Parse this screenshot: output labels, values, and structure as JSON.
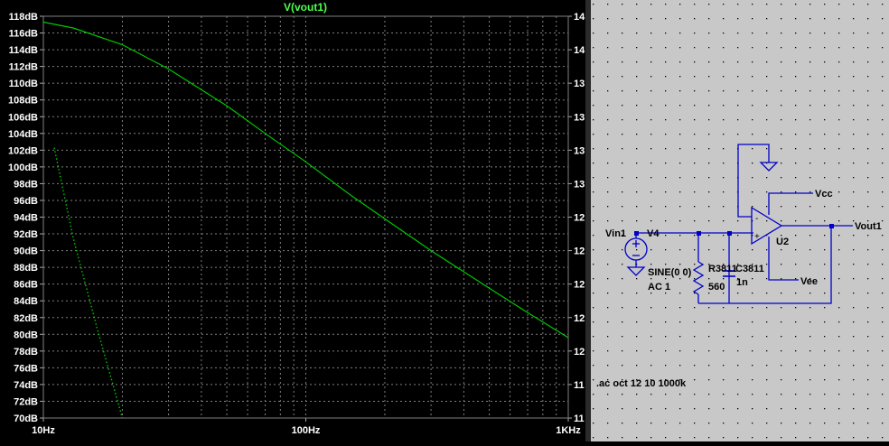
{
  "plot": {
    "title": "V(vout1)",
    "colors": {
      "background": "#000000",
      "grid": "#7f7f7f",
      "trace": "#00c800",
      "text": "#ffffff",
      "title": "#4cff4c"
    }
  },
  "chart_data": {
    "type": "line",
    "title": "V(vout1)",
    "x_scale": "log",
    "xlim": [
      10,
      1000
    ],
    "ylim": [
      70,
      118
    ],
    "y_ticks": [
      "70dB",
      "72dB",
      "74dB",
      "76dB",
      "78dB",
      "80dB",
      "82dB",
      "84dB",
      "86dB",
      "88dB",
      "90dB",
      "92dB",
      "94dB",
      "96dB",
      "98dB",
      "100dB",
      "102dB",
      "104dB",
      "106dB",
      "108dB",
      "110dB",
      "112dB",
      "114dB",
      "116dB",
      "118dB"
    ],
    "x_ticks": [
      {
        "value": 10,
        "label": "10Hz"
      },
      {
        "value": 100,
        "label": "100Hz"
      },
      {
        "value": 1000,
        "label": "1KHz"
      }
    ],
    "right_ticks": [
      "14",
      "14",
      "13",
      "13",
      "13",
      "13",
      "12",
      "12",
      "12",
      "12",
      "12",
      "11",
      "11"
    ],
    "grid": true,
    "series": [
      {
        "style": "solid",
        "x": [
          10,
          13,
          20,
          30,
          50,
          70,
          100,
          150,
          200,
          300,
          500,
          700,
          1000
        ],
        "y": [
          117.3,
          116.6,
          114.6,
          111.7,
          107.3,
          104.0,
          100.6,
          96.5,
          93.8,
          90.0,
          85.5,
          82.6,
          79.6
        ]
      },
      {
        "style": "dotted",
        "x": [
          11,
          13,
          16,
          20
        ],
        "y": [
          102.3,
          91.5,
          80.8,
          70.0
        ]
      }
    ]
  },
  "schematic": {
    "labels": {
      "vin1": "Vin1",
      "v4": "V4",
      "sine": "SINE(0 0)",
      "ac": "AC 1",
      "r3811": "R3811",
      "c3811": "C3811",
      "r_value": "560",
      "c_value": "1n",
      "u2": "U2",
      "vcc": "Vcc",
      "vee": "Vee",
      "vout1": "Vout1",
      "directive": ".ac oct 12 10 1000k",
      "plus": "+",
      "minus": "-"
    },
    "colors": {
      "wire": "#0000c8",
      "text": "#000000",
      "background": "#c8c8c8",
      "dot": "#000000"
    }
  }
}
